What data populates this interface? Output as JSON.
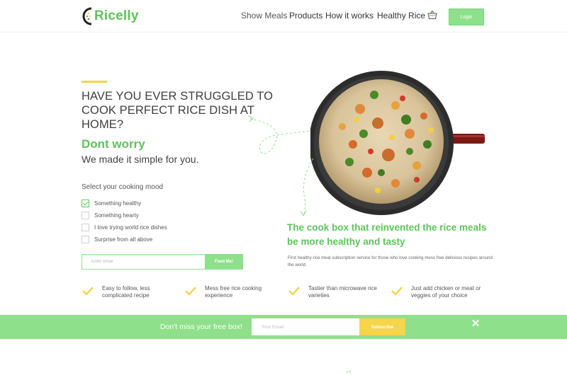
{
  "brand": {
    "name": "Ricelly",
    "color": "#5dc45a",
    "accent": "#8ee08a",
    "highlight": "#f7d44a"
  },
  "nav": {
    "items": [
      {
        "label": "Show Meals"
      },
      {
        "label": "Products"
      },
      {
        "label": "How it works"
      },
      {
        "label": "Healthy Rice"
      }
    ],
    "basket_icon": "basket-icon",
    "login_label": "Login"
  },
  "hero": {
    "title": "HAVE YOU EVER STRUGGLED TO COOK PERFECT RICE DISH AT HOME?",
    "dont_worry": "Dont worry",
    "made_simple": "We made it simple for you.",
    "mood_label": "Select your cooking mood",
    "moods": [
      {
        "label": "Something healthy",
        "checked": true
      },
      {
        "label": "Something hearty",
        "checked": false
      },
      {
        "label": "I love trying world rice dishes",
        "checked": false
      },
      {
        "label": "Surprise from all above",
        "checked": false
      }
    ],
    "email_placeholder": "Enter email",
    "feed_label": "Feed Me!"
  },
  "tagline": {
    "title": "The cook box that reinvented the rice meals be more healthy and tasty",
    "subtitle": "First healthy rice meal subscription service for those who love cooking mess free delicious recipes around the world"
  },
  "features": [
    {
      "text": "Easy to follow, less complicated recipe"
    },
    {
      "text": "Mess free rice cooking experience"
    },
    {
      "text": "Tastier than microwave rice varieties"
    },
    {
      "text": "Just add chicken or meat or veggies of your choice"
    }
  ],
  "banner": {
    "text": "Don't miss your free box!",
    "email_placeholder": "Your Email",
    "subscribe_label": "Subscribe",
    "close_icon": "close-icon"
  }
}
